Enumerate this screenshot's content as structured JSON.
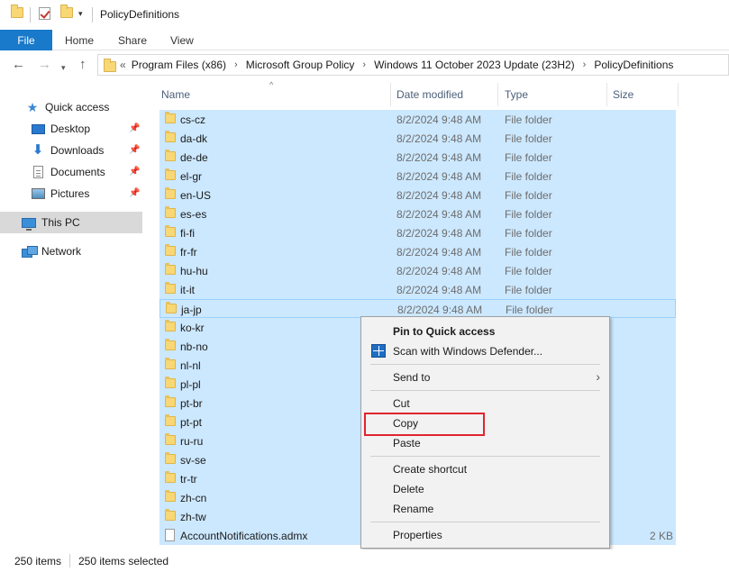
{
  "window": {
    "title": "PolicyDefinitions"
  },
  "ribbon": {
    "tabs": [
      "File",
      "Home",
      "Share",
      "View"
    ]
  },
  "address": {
    "overflow": "«",
    "segments": [
      "Program Files (x86)",
      "Microsoft Group Policy",
      "Windows 11 October 2023 Update (23H2)",
      "PolicyDefinitions"
    ]
  },
  "columns": {
    "name": "Name",
    "date": "Date modified",
    "type": "Type",
    "size": "Size"
  },
  "navpane": {
    "quick_access": "Quick access",
    "desktop": "Desktop",
    "downloads": "Downloads",
    "documents": "Documents",
    "pictures": "Pictures",
    "this_pc": "This PC",
    "network": "Network"
  },
  "files": [
    {
      "name": "cs-cz",
      "date": "8/2/2024 9:48 AM",
      "type": "File folder",
      "size": ""
    },
    {
      "name": "da-dk",
      "date": "8/2/2024 9:48 AM",
      "type": "File folder",
      "size": ""
    },
    {
      "name": "de-de",
      "date": "8/2/2024 9:48 AM",
      "type": "File folder",
      "size": ""
    },
    {
      "name": "el-gr",
      "date": "8/2/2024 9:48 AM",
      "type": "File folder",
      "size": ""
    },
    {
      "name": "en-US",
      "date": "8/2/2024 9:48 AM",
      "type": "File folder",
      "size": ""
    },
    {
      "name": "es-es",
      "date": "8/2/2024 9:48 AM",
      "type": "File folder",
      "size": ""
    },
    {
      "name": "fi-fi",
      "date": "8/2/2024 9:48 AM",
      "type": "File folder",
      "size": ""
    },
    {
      "name": "fr-fr",
      "date": "8/2/2024 9:48 AM",
      "type": "File folder",
      "size": ""
    },
    {
      "name": "hu-hu",
      "date": "8/2/2024 9:48 AM",
      "type": "File folder",
      "size": ""
    },
    {
      "name": "it-it",
      "date": "8/2/2024 9:48 AM",
      "type": "File folder",
      "size": ""
    },
    {
      "name": "ja-jp",
      "date": "8/2/2024 9:48 AM",
      "type": "File folder",
      "size": ""
    },
    {
      "name": "ko-kr",
      "date": "",
      "type": "",
      "size": ""
    },
    {
      "name": "nb-no",
      "date": "",
      "type": "",
      "size": ""
    },
    {
      "name": "nl-nl",
      "date": "",
      "type": "",
      "size": ""
    },
    {
      "name": "pl-pl",
      "date": "",
      "type": "",
      "size": ""
    },
    {
      "name": "pt-br",
      "date": "",
      "type": "",
      "size": ""
    },
    {
      "name": "pt-pt",
      "date": "",
      "type": "",
      "size": ""
    },
    {
      "name": "ru-ru",
      "date": "",
      "type": "",
      "size": ""
    },
    {
      "name": "sv-se",
      "date": "",
      "type": "",
      "size": ""
    },
    {
      "name": "tr-tr",
      "date": "",
      "type": "",
      "size": ""
    },
    {
      "name": "zh-cn",
      "date": "",
      "type": "",
      "size": ""
    },
    {
      "name": "zh-tw",
      "date": "",
      "type": "",
      "size": ""
    },
    {
      "name": "AccountNotifications.admx",
      "date": "",
      "type": "",
      "size": "2 KB"
    }
  ],
  "context_menu": {
    "pin": "Pin to Quick access",
    "scan": "Scan with Windows Defender...",
    "send_to": "Send to",
    "cut": "Cut",
    "copy": "Copy",
    "paste": "Paste",
    "create_shortcut": "Create shortcut",
    "delete": "Delete",
    "rename": "Rename",
    "properties": "Properties"
  },
  "status": {
    "items": "250 items",
    "selected": "250 items selected"
  },
  "colors": {
    "selection": "#cce8ff",
    "file_tab": "#1979ca",
    "highlight_box": "#e0252d"
  }
}
